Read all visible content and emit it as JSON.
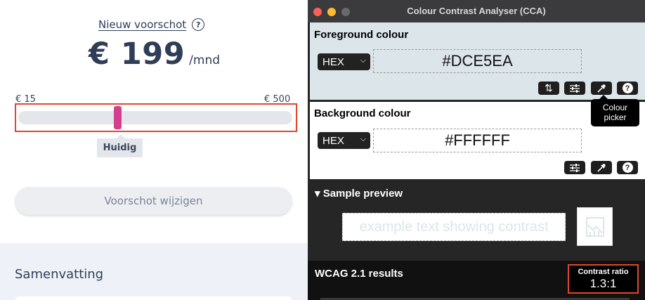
{
  "left_panel": {
    "advance_link": "Nieuw voorschot",
    "help_icon": "?",
    "amount": "€ 199",
    "amount_unit": "/mnd",
    "slider": {
      "min_label": "€ 15",
      "max_label": "€ 500",
      "current_label": "Huidig",
      "value_fraction": 0.36
    },
    "change_button": "Voorschot wijzigen",
    "summary_title": "Samenvatting"
  },
  "cca": {
    "window_title": "Colour Contrast Analyser (CCA)",
    "foreground": {
      "title": "Foreground colour",
      "format": "HEX",
      "value": "#DCE5EA"
    },
    "background": {
      "title": "Background colour",
      "format": "HEX",
      "value": "#FFFFFF"
    },
    "tooltip": "Colour picker",
    "sample": {
      "title": "▾ Sample preview",
      "text": "example text showing contrast"
    },
    "wcag": {
      "title": "WCAG 2.1 results",
      "ratio_label": "Contrast ratio",
      "ratio_value": "1.3:1"
    }
  },
  "icons": {
    "swap": "swap-icon",
    "sliders": "sliders-icon",
    "picker": "eyedropper-icon",
    "help": "help-icon",
    "chevron": "chevron-down-icon",
    "image": "image-icon"
  },
  "colors": {
    "highlight": "#e0472c",
    "slider_thumb": "#d23f8e",
    "text_dark": "#2f3e56",
    "fg_swatch": "#DCE5EA"
  }
}
